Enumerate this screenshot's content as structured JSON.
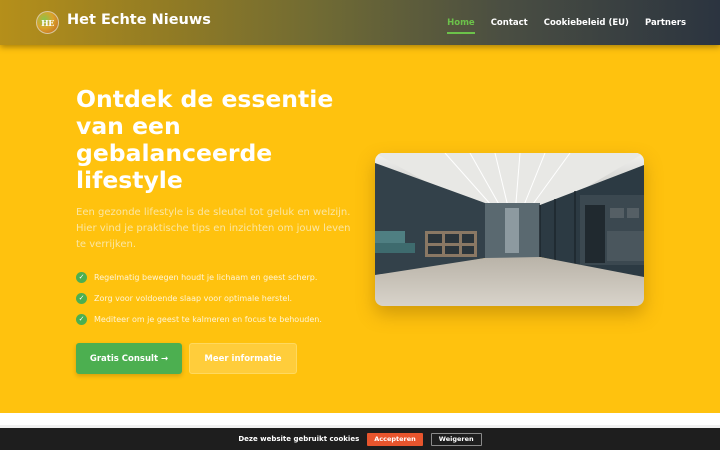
{
  "header": {
    "logo_text": "HE",
    "brand": "Het Echte Nieuws",
    "nav": [
      {
        "label": "Home",
        "active": true
      },
      {
        "label": "Contact",
        "active": false
      },
      {
        "label": "Cookiebeleid (EU)",
        "active": false
      },
      {
        "label": "Partners",
        "active": false
      }
    ]
  },
  "hero": {
    "title": "Ontdek de essentie van een gebalanceerde lifestyle",
    "subtitle": "Een gezonde lifestyle is de sleutel tot geluk en welzijn. Hier vind je praktische tips en inzichten om jouw leven te verrijken.",
    "bullets": [
      "Regelmatig bewegen houdt je lichaam en geest scherp.",
      "Zorg voor voldoende slaap voor optimale herstel.",
      "Mediteer om je geest te kalmeren en focus te behouden."
    ],
    "primary_button": "Gratis Consult →",
    "secondary_button": "Meer informatie",
    "image_alt": "modern-office-hallway"
  },
  "cookie": {
    "text": "Deze website gebruikt cookies",
    "accept": "Accepteren",
    "decline": "Weigeren"
  },
  "colors": {
    "background": "#ffc20e",
    "accent_green": "#4caf50",
    "cookie_accept": "#e8552d",
    "cookie_bar": "#1e1e1e"
  }
}
